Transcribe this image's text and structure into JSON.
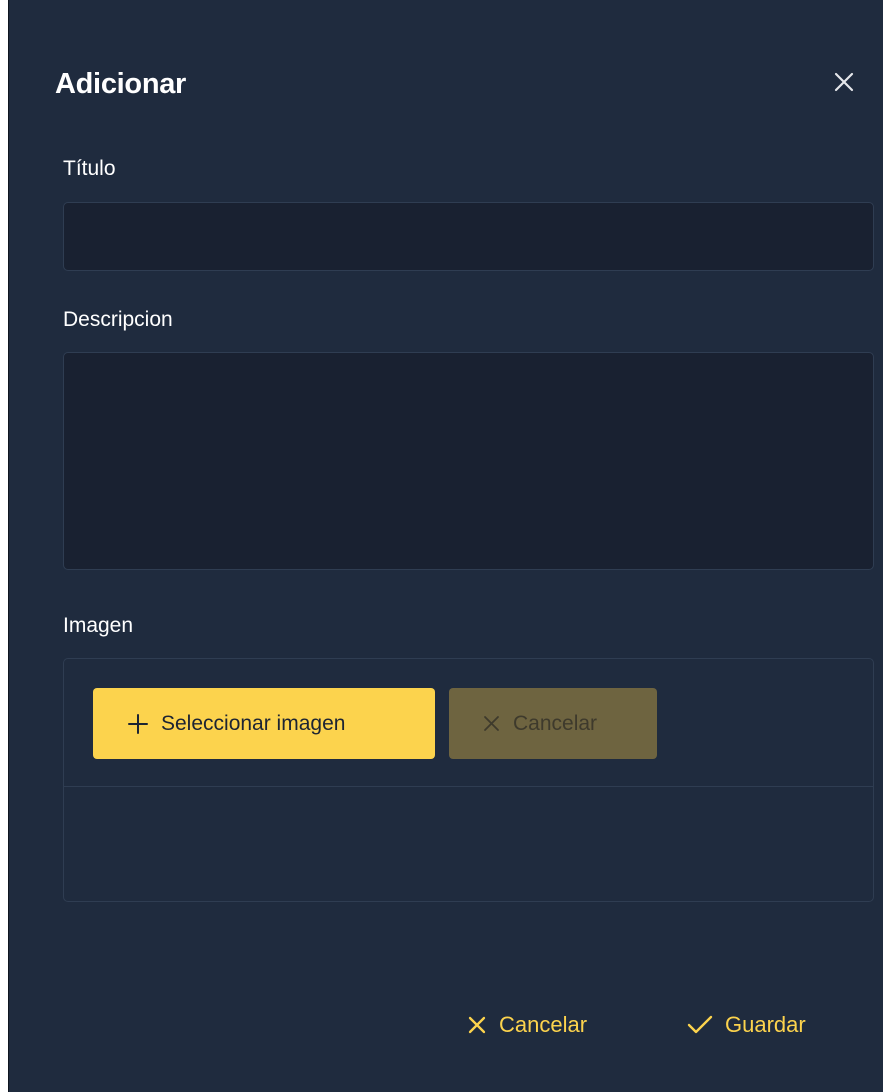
{
  "dialog": {
    "title": "Adicionar",
    "close_icon": "close-icon"
  },
  "form": {
    "title_label": "Título",
    "title_value": "",
    "description_label": "Descripcion",
    "description_value": "",
    "image_label": "Imagen"
  },
  "uploader": {
    "select_label": "Seleccionar imagen",
    "select_icon": "plus-icon",
    "cancel_label": "Cancelar",
    "cancel_icon": "close-icon"
  },
  "footer": {
    "cancel_label": "Cancelar",
    "cancel_icon": "close-icon",
    "save_label": "Guardar",
    "save_icon": "check-icon"
  },
  "colors": {
    "background": "#1f2b3e",
    "input_background": "#192131",
    "border": "#2f3d52",
    "accent": "#fcd34d",
    "accent_disabled": "#6e6440",
    "text": "#ffffff"
  }
}
